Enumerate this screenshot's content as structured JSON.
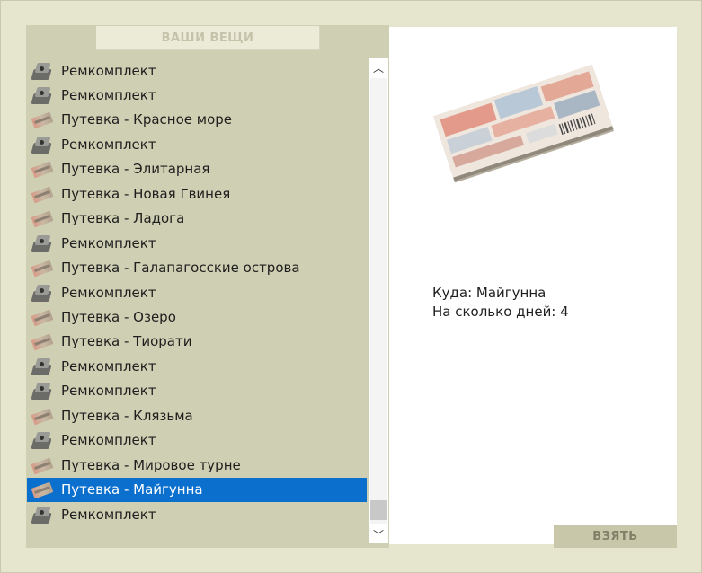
{
  "header": {
    "title": "ВАШИ ВЕЩИ"
  },
  "items": [
    {
      "label": "Ремкомплект",
      "icon": "repair-kit-icon",
      "selected": false
    },
    {
      "label": "Ремкомплект",
      "icon": "repair-kit-icon",
      "selected": false
    },
    {
      "label": "Путевка - Красное море",
      "icon": "voucher-icon",
      "selected": false
    },
    {
      "label": "Ремкомплект",
      "icon": "repair-kit-icon",
      "selected": false
    },
    {
      "label": "Путевка - Элитарная",
      "icon": "voucher-icon",
      "selected": false
    },
    {
      "label": "Путевка - Новая Гвинея",
      "icon": "voucher-icon",
      "selected": false
    },
    {
      "label": "Путевка - Ладога",
      "icon": "voucher-icon",
      "selected": false
    },
    {
      "label": "Ремкомплект",
      "icon": "repair-kit-icon",
      "selected": false
    },
    {
      "label": "Путевка - Галапагосские острова",
      "icon": "voucher-icon",
      "selected": false
    },
    {
      "label": "Ремкомплект",
      "icon": "repair-kit-icon",
      "selected": false
    },
    {
      "label": "Путевка - Озеро",
      "icon": "voucher-icon",
      "selected": false
    },
    {
      "label": "Путевка - Тиорати",
      "icon": "voucher-icon",
      "selected": false
    },
    {
      "label": "Ремкомплект",
      "icon": "repair-kit-icon",
      "selected": false
    },
    {
      "label": "Ремкомплект",
      "icon": "repair-kit-icon",
      "selected": false
    },
    {
      "label": "Путевка - Клязьма",
      "icon": "voucher-icon",
      "selected": false
    },
    {
      "label": "Ремкомплект",
      "icon": "repair-kit-icon",
      "selected": false
    },
    {
      "label": "Путевка - Мировое турне",
      "icon": "voucher-icon",
      "selected": false
    },
    {
      "label": "Путевка - Майгунна",
      "icon": "voucher-icon",
      "selected": true
    },
    {
      "label": "Ремкомплект",
      "icon": "repair-kit-icon",
      "selected": false
    }
  ],
  "details": {
    "destination": "Куда: Майгунна",
    "days": "На сколько дней: 4"
  },
  "actions": {
    "take_label": "ВЗЯТЬ"
  },
  "colors": {
    "selection": "#0b6fce",
    "panel": "#cfcfb3",
    "background": "#e6e6cf"
  }
}
